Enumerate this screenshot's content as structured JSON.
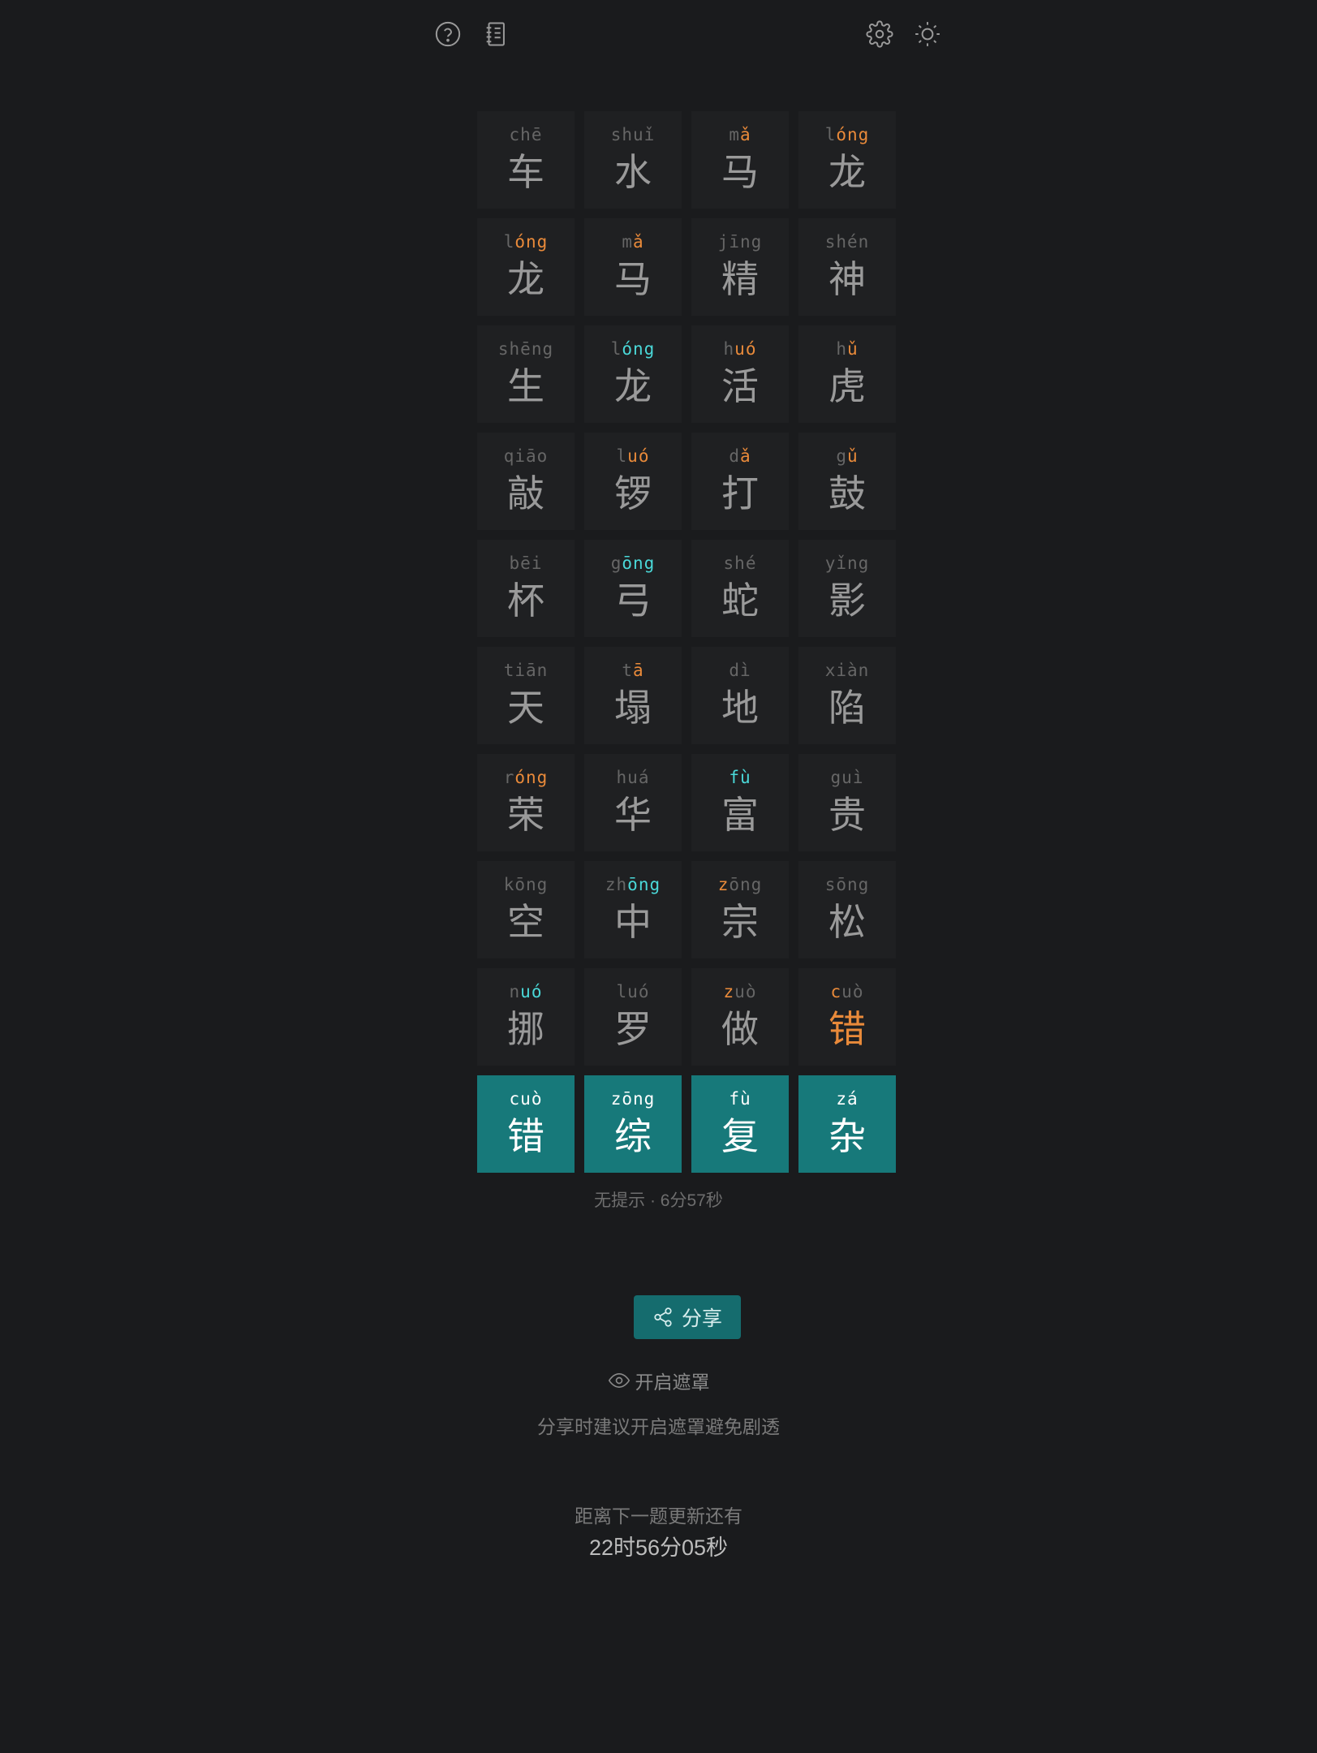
{
  "toolbar": {
    "help_icon": "help-circle-icon",
    "notebook_icon": "notebook-icon",
    "settings_icon": "gear-icon",
    "theme_icon": "sun-icon"
  },
  "colors": {
    "background": "#1a1b1d",
    "cell": "#1f2022",
    "filled": "#17797a",
    "correct": "#4ad8d8",
    "present": "#e98a3a",
    "absent": "#666666"
  },
  "rows": [
    [
      {
        "hanzi": "车",
        "pinyin": [
          {
            "t": "ch",
            "s": "a"
          },
          {
            "t": "ē",
            "s": "a"
          }
        ]
      },
      {
        "hanzi": "水",
        "pinyin": [
          {
            "t": "shuǐ",
            "s": "a"
          }
        ]
      },
      {
        "hanzi": "马",
        "pinyin": [
          {
            "t": "m",
            "s": "a"
          },
          {
            "t": "ǎ",
            "s": "n"
          }
        ]
      },
      {
        "hanzi": "龙",
        "pinyin": [
          {
            "t": "l",
            "s": "a"
          },
          {
            "t": "óng",
            "s": "n"
          }
        ]
      }
    ],
    [
      {
        "hanzi": "龙",
        "pinyin": [
          {
            "t": "l",
            "s": "a"
          },
          {
            "t": "óng",
            "s": "n"
          }
        ]
      },
      {
        "hanzi": "马",
        "pinyin": [
          {
            "t": "m",
            "s": "a"
          },
          {
            "t": "ǎ",
            "s": "n"
          }
        ]
      },
      {
        "hanzi": "精",
        "pinyin": [
          {
            "t": "jīng",
            "s": "a"
          }
        ]
      },
      {
        "hanzi": "神",
        "pinyin": [
          {
            "t": "shén",
            "s": "a"
          }
        ]
      }
    ],
    [
      {
        "hanzi": "生",
        "pinyin": [
          {
            "t": "shēng",
            "s": "a"
          }
        ]
      },
      {
        "hanzi": "龙",
        "pinyin": [
          {
            "t": "l",
            "s": "a"
          },
          {
            "t": "óng",
            "s": "c"
          }
        ]
      },
      {
        "hanzi": "活",
        "pinyin": [
          {
            "t": "h",
            "s": "a"
          },
          {
            "t": "uó",
            "s": "n"
          }
        ]
      },
      {
        "hanzi": "虎",
        "pinyin": [
          {
            "t": "h",
            "s": "a"
          },
          {
            "t": "ǔ",
            "s": "n"
          }
        ]
      }
    ],
    [
      {
        "hanzi": "敲",
        "pinyin": [
          {
            "t": "qiāo",
            "s": "a"
          }
        ]
      },
      {
        "hanzi": "锣",
        "pinyin": [
          {
            "t": "l",
            "s": "a"
          },
          {
            "t": "uó",
            "s": "n"
          }
        ]
      },
      {
        "hanzi": "打",
        "pinyin": [
          {
            "t": "d",
            "s": "a"
          },
          {
            "t": "ǎ",
            "s": "n"
          }
        ]
      },
      {
        "hanzi": "鼓",
        "pinyin": [
          {
            "t": "g",
            "s": "a"
          },
          {
            "t": "ǔ",
            "s": "n"
          }
        ]
      }
    ],
    [
      {
        "hanzi": "杯",
        "pinyin": [
          {
            "t": "bēi",
            "s": "a"
          }
        ]
      },
      {
        "hanzi": "弓",
        "pinyin": [
          {
            "t": "g",
            "s": "a"
          },
          {
            "t": "ōng",
            "s": "c"
          }
        ]
      },
      {
        "hanzi": "蛇",
        "pinyin": [
          {
            "t": "shé",
            "s": "a"
          }
        ]
      },
      {
        "hanzi": "影",
        "pinyin": [
          {
            "t": "yǐng",
            "s": "a"
          }
        ]
      }
    ],
    [
      {
        "hanzi": "天",
        "pinyin": [
          {
            "t": "tiān",
            "s": "a"
          }
        ]
      },
      {
        "hanzi": "塌",
        "pinyin": [
          {
            "t": "t",
            "s": "a"
          },
          {
            "t": "ā",
            "s": "n"
          }
        ]
      },
      {
        "hanzi": "地",
        "pinyin": [
          {
            "t": "dì",
            "s": "a"
          }
        ]
      },
      {
        "hanzi": "陷",
        "pinyin": [
          {
            "t": "xiàn",
            "s": "a"
          }
        ]
      }
    ],
    [
      {
        "hanzi": "荣",
        "pinyin": [
          {
            "t": "r",
            "s": "a"
          },
          {
            "t": "óng",
            "s": "n"
          }
        ]
      },
      {
        "hanzi": "华",
        "pinyin": [
          {
            "t": "huá",
            "s": "a"
          }
        ]
      },
      {
        "hanzi": "富",
        "hanzi_state": "a",
        "pinyin": [
          {
            "t": "fù",
            "s": "c"
          }
        ]
      },
      {
        "hanzi": "贵",
        "pinyin": [
          {
            "t": "guì",
            "s": "a"
          }
        ]
      }
    ],
    [
      {
        "hanzi": "空",
        "pinyin": [
          {
            "t": "kōng",
            "s": "a"
          }
        ]
      },
      {
        "hanzi": "中",
        "pinyin": [
          {
            "t": "zh",
            "s": "a"
          },
          {
            "t": "ōng",
            "s": "c"
          }
        ]
      },
      {
        "hanzi": "宗",
        "pinyin": [
          {
            "t": "z",
            "s": "n"
          },
          {
            "t": "ōng",
            "s": "a"
          }
        ]
      },
      {
        "hanzi": "松",
        "pinyin": [
          {
            "t": "sōng",
            "s": "a"
          }
        ]
      }
    ],
    [
      {
        "hanzi": "挪",
        "pinyin": [
          {
            "t": "n",
            "s": "a"
          },
          {
            "t": "uó",
            "s": "c"
          }
        ]
      },
      {
        "hanzi": "罗",
        "pinyin": [
          {
            "t": "luó",
            "s": "a"
          }
        ]
      },
      {
        "hanzi": "做",
        "pinyin": [
          {
            "t": "z",
            "s": "n"
          },
          {
            "t": "uò",
            "s": "a"
          }
        ]
      },
      {
        "hanzi": "错",
        "hanzi_state": "n",
        "pinyin": [
          {
            "t": "c",
            "s": "n"
          },
          {
            "t": "uò",
            "s": "a"
          }
        ]
      }
    ],
    [
      {
        "hanzi": "错",
        "filled": true,
        "pinyin": [
          {
            "t": "cuò",
            "s": "f"
          }
        ]
      },
      {
        "hanzi": "综",
        "filled": true,
        "pinyin": [
          {
            "t": "zōng",
            "s": "f"
          }
        ]
      },
      {
        "hanzi": "复",
        "filled": true,
        "pinyin": [
          {
            "t": "fù",
            "s": "f"
          }
        ]
      },
      {
        "hanzi": "杂",
        "filled": true,
        "pinyin": [
          {
            "t": "zá",
            "s": "f"
          }
        ]
      }
    ]
  ],
  "status": "无提示 · 6分57秒",
  "share": {
    "label": "分享",
    "icon": "share-icon"
  },
  "mask": {
    "label": "开启遮罩",
    "icon": "eye-icon",
    "hint": "分享时建议开启遮罩避免剧透"
  },
  "next": {
    "label": "距离下一题更新还有",
    "countdown": "22时56分05秒"
  }
}
